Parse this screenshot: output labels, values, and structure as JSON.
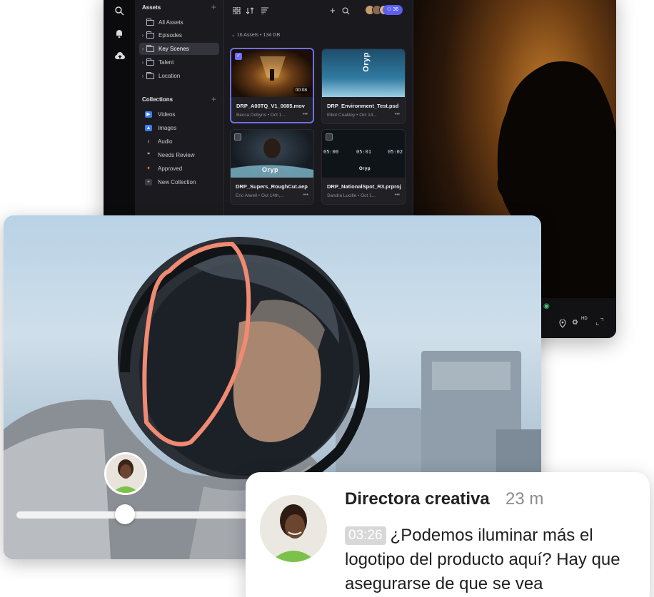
{
  "assets_panel": {
    "header": "Assets",
    "tree": [
      {
        "label": "All Assets"
      },
      {
        "label": "Episodes"
      },
      {
        "label": "Key Scenes"
      },
      {
        "label": "Talent"
      },
      {
        "label": "Location"
      }
    ],
    "collections_header": "Collections",
    "collections": [
      {
        "label": "Videos",
        "color": "#3e7bf2"
      },
      {
        "label": "Images",
        "color": "#3e7bf2"
      },
      {
        "label": "Audio",
        "color": "#e0e0e0"
      },
      {
        "label": "Needs Review",
        "color": "#e0e0e0"
      },
      {
        "label": "Approved",
        "color": "#f2a33a"
      },
      {
        "label": "New Collection",
        "color": "#5a5a62"
      }
    ]
  },
  "grid": {
    "count_label": "16 Assets",
    "size_label": "134 GB",
    "share_count": "36",
    "cards": [
      {
        "title": "DRP_A00TQ_V1_0085.mov",
        "meta": "Becca Dobyns  •  Oct 1...",
        "duration": "00:08"
      },
      {
        "title": "DRP_Environment_Test.psd",
        "meta": "Elliot Coakley  •  Oct 14..."
      },
      {
        "title": "DRP_Supers_RoughCut.aep",
        "meta": "Eric Atwell  •  Oct 14th,..."
      },
      {
        "title": "DRP_NationalSpot_R3.prproj",
        "meta": "Sandra Lucille  •  Oct 1..."
      }
    ],
    "thumb_text": "Oryp",
    "timecodes": [
      "05:00",
      "05:01",
      "05:02"
    ]
  },
  "viewer": {
    "quality_label": "HD"
  },
  "comment": {
    "author": "Directora creativa",
    "time_ago": "23 m",
    "timecode": "03:26",
    "text": "¿Podemos iluminar más el logotipo del producto aquí? Hay que asegurarse de que se vea"
  },
  "colors": {
    "accent": "#6e70f5",
    "annotation": "#f08a72"
  }
}
